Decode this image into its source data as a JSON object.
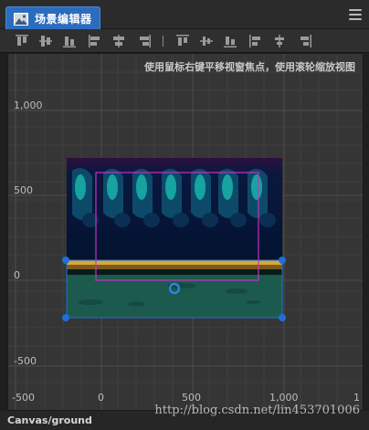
{
  "tab": {
    "label": "场景编辑器",
    "icon": "scene-editor-icon"
  },
  "menu": {
    "icon": "hamburger-menu-icon"
  },
  "toolbar": {
    "group1": [
      "align-top-icon",
      "align-vertical-center-icon",
      "align-bottom-icon",
      "align-left-icon",
      "align-horizontal-center-icon",
      "align-right-icon"
    ],
    "separator": "|",
    "group2": [
      "distribute-top-icon",
      "distribute-vertical-center-icon",
      "distribute-bottom-icon",
      "distribute-left-icon",
      "distribute-horizontal-center-icon",
      "distribute-right-icon"
    ]
  },
  "viewport": {
    "hint": "使用鼠标右键平移视窗焦点，使用滚轮缩放视图",
    "y_axis_labels": [
      "1,000",
      "500",
      "0",
      "-500"
    ],
    "x_axis_labels": [
      "-500",
      "0",
      "500",
      "1,000",
      "1"
    ],
    "colors": {
      "background": "#353535",
      "grid": "#474747",
      "selection_outline": "#c233c2",
      "handle": "#1e6fd9",
      "ground_fill": "#1c5a4e",
      "sky_top": "#2c0f3e",
      "sky_mid": "#041737",
      "dirt_stripe": "#d8a83a"
    }
  },
  "status": {
    "path": "Canvas/ground"
  },
  "watermark": "http://blog.csdn.net/lin453701006"
}
